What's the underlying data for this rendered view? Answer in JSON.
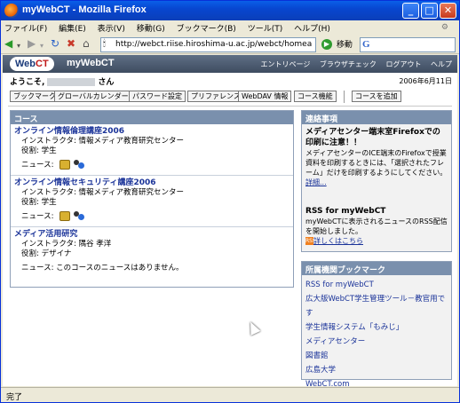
{
  "window": {
    "title": "myWebCT - Mozilla Firefox",
    "controls": {
      "minimize": "_",
      "maximize": "□",
      "close": "✕"
    }
  },
  "menubar": {
    "items": [
      "ファイル(F)",
      "編集(E)",
      "表示(V)",
      "移動(G)",
      "ブックマーク(B)",
      "ツール(T)",
      "ヘルプ(H)"
    ]
  },
  "navbar": {
    "url": "http://webct.riise.hiroshima-u.ac.jp/webct/homearea/h",
    "go_label": "移動",
    "search_logo": "G"
  },
  "webct": {
    "logo_prefix": "Web",
    "logo_suffix": "CT",
    "title": "myWebCT",
    "links": [
      "エントリページ",
      "ブラウザチェック",
      "ログアウト",
      "ヘルプ"
    ],
    "welcome_prefix": "ようこそ,",
    "welcome_suffix": "さん",
    "date": "2006年6月11日"
  },
  "toolbar": {
    "buttons": [
      "ブックマーク",
      "グローバルカレンダー",
      "パスワード設定",
      "プリファレンス",
      "WebDAV 情報",
      "コース機能"
    ],
    "add_course": "コースを追加"
  },
  "courses": {
    "header": "コース",
    "items": [
      {
        "title": "オンライン情報倫理講座2006",
        "instructor": "インストラクタ: 情報メディア教育研究センター",
        "role": "役割: 学生",
        "news_label": "ニュース:"
      },
      {
        "title": "オンライン情報セキュリティ講座2006",
        "instructor": "インストラクタ: 情報メディア教育研究センター",
        "role": "役割: 学生",
        "news_label": "ニュース:"
      },
      {
        "title": "メディア活用研究",
        "instructor": "インストラクタ: 隅谷 孝洋",
        "role": "役割: デザイナ",
        "news_label": "ニュース: このコースのニュースはありません。"
      }
    ]
  },
  "notice": {
    "header": "連絡事項",
    "title": "メディアセンター端末室Firefoxでの印刷に注意！！",
    "body": "メディアセンターのICE端末のFirefoxで授業資料を印刷するときには、「選択されたフレーム」だけを印刷するようにしてください。",
    "details_link": "詳細...",
    "rss_title": "RSS for myWebCT",
    "rss_body": "myWebCTに表示されるニュースのRSS配信を開始しました。",
    "rss_link": "詳しくはこちら",
    "rss_icon": "RSS"
  },
  "bookmarks": {
    "header": "所属機関ブックマーク",
    "items": [
      "RSS for myWebCT",
      "広大版WebCT学生管理ツール－教官用です",
      "学生情報システム「もみじ」",
      "メディアセンター",
      "図書館",
      "広島大学",
      "WebCT.com"
    ]
  },
  "status": {
    "text": "完了"
  }
}
